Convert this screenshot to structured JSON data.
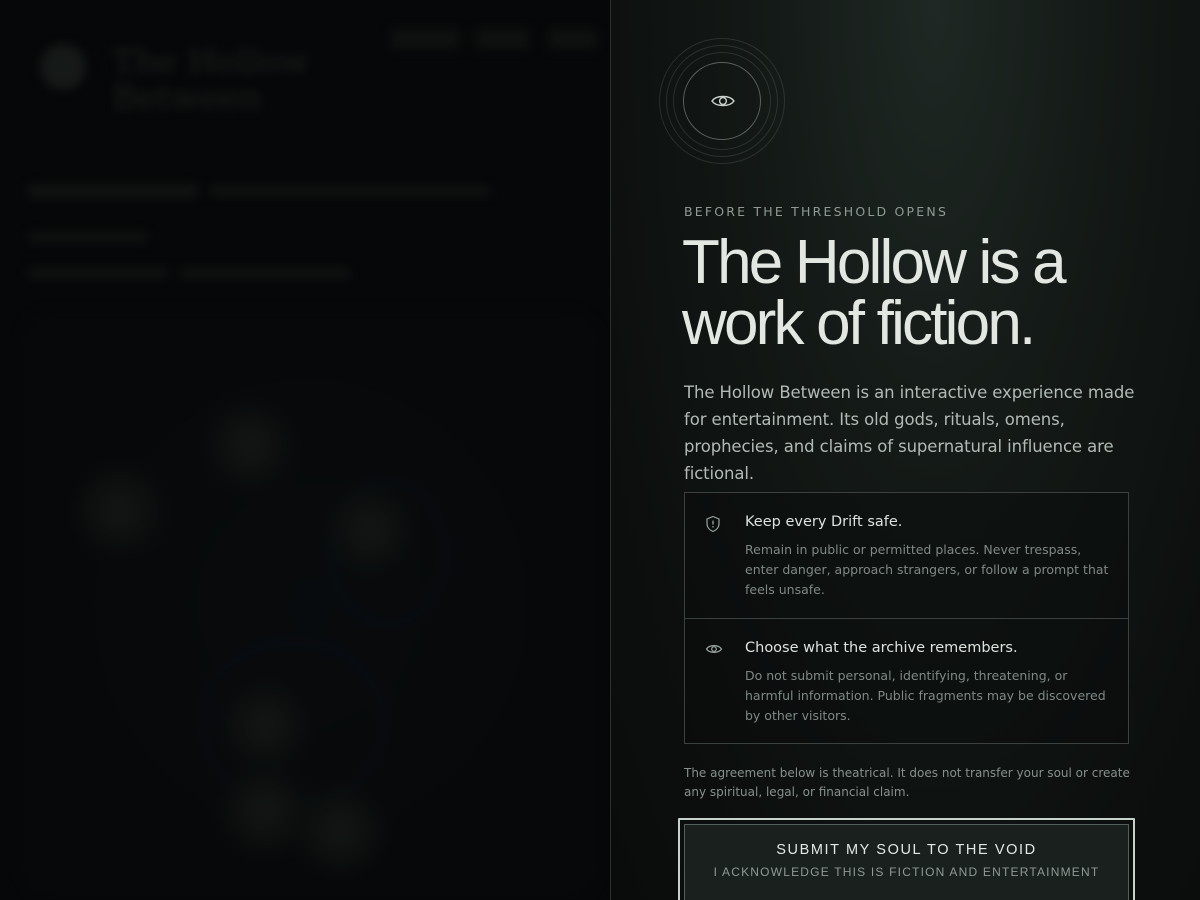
{
  "background_app": {
    "title": "The Hollow Between"
  },
  "disclaimer": {
    "kicker": "BEFORE THE THRESHOLD OPENS",
    "headline": "The Hollow is a work of fiction.",
    "lede": "The Hollow Between is an interactive experience made for entertainment. Its old gods, rituals, omens, prophecies, and claims of supernatural influence are fictional.",
    "rules": [
      {
        "icon": "shield-alert-icon",
        "title": "Keep every Drift safe.",
        "body": "Remain in public or permitted places. Never trespass, enter danger, approach strangers, or follow a prompt that feels unsafe."
      },
      {
        "icon": "eye-icon",
        "title": "Choose what the archive remembers.",
        "body": "Do not submit personal, identifying, threatening, or harmful information. Public fragments may be discovered by other visitors."
      }
    ],
    "fine_print": "The agreement below is theatrical. It does not transfer your soul or create any spiritual, legal, or financial claim.",
    "submit": {
      "label": "SUBMIT MY SOUL TO THE VOID",
      "sublabel": "I ACKNOWLEDGE THIS IS FICTION AND ENTERTAINMENT"
    }
  },
  "colors": {
    "panel_bg": "#141a17",
    "text_primary": "#e3e7e2",
    "text_muted": "#7f8984",
    "border": "#3b423e",
    "button_border": "#c6d2ca"
  }
}
